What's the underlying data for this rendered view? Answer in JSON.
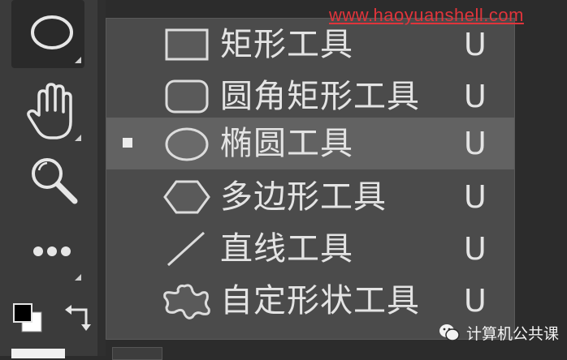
{
  "watermark": "www.haoyuanshell.com",
  "brand": {
    "text": "计算机公共课",
    "icon": "wechat-icon"
  },
  "toolbar": {
    "tools": [
      {
        "name": "ellipse-tool",
        "icon": "ellipse-icon",
        "active": true
      },
      {
        "name": "hand-tool",
        "icon": "hand-icon",
        "active": false
      },
      {
        "name": "zoom-tool",
        "icon": "magnifier-icon",
        "active": false
      },
      {
        "name": "more-tools",
        "icon": "ellipsis-icon",
        "active": false
      }
    ],
    "swatches": {
      "foreground": "#000000",
      "background": "#ffffff"
    }
  },
  "menu": {
    "items": [
      {
        "label": "矩形工具",
        "shortcut": "U",
        "icon": "rectangle-icon",
        "selected": false
      },
      {
        "label": "圆角矩形工具",
        "shortcut": "U",
        "icon": "rounded-rectangle-icon",
        "selected": false
      },
      {
        "label": "椭圆工具",
        "shortcut": "U",
        "icon": "ellipse-icon",
        "selected": true
      },
      {
        "label": "多边形工具",
        "shortcut": "U",
        "icon": "hexagon-icon",
        "selected": false
      },
      {
        "label": "直线工具",
        "shortcut": "U",
        "icon": "line-icon",
        "selected": false
      },
      {
        "label": "自定形状工具",
        "shortcut": "U",
        "icon": "custom-shape-icon",
        "selected": false
      }
    ]
  },
  "colors": {
    "menu_bg": "#4b4b4b",
    "menu_selected": "#626262",
    "toolbar_bg": "#3b3b3b",
    "text": "#e4e4e4",
    "watermark": "#e0343b"
  }
}
